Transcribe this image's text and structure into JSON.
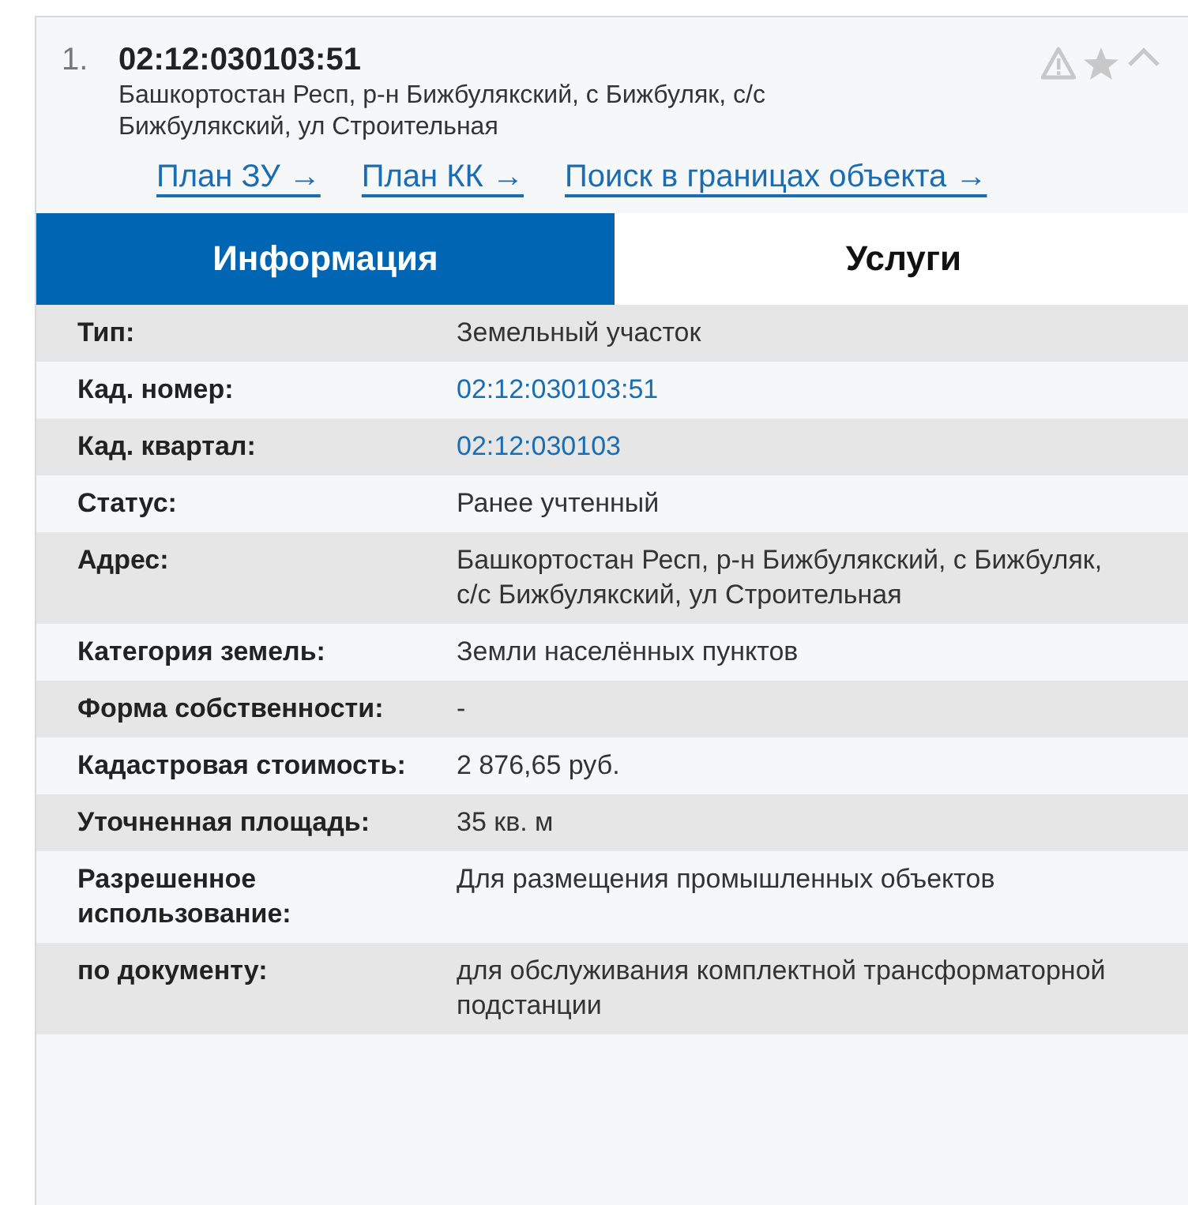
{
  "result": {
    "index": "1.",
    "title": "02:12:030103:51",
    "address": "Башкортостан Респ, р-н Бижбулякский, с Бижбуляк, с/с Бижбулякский, ул Строительная",
    "links": [
      "План ЗУ →",
      "План КК →",
      "Поиск в границах объекта →"
    ]
  },
  "tabs": [
    {
      "label": "Информация",
      "selected": true
    },
    {
      "label": "Услуги",
      "selected": false
    }
  ],
  "rows": [
    {
      "label": "Тип:",
      "value": "Земельный участок",
      "kind": "text"
    },
    {
      "label": "Кад. номер:",
      "value": "02:12:030103:51",
      "kind": "link"
    },
    {
      "label": "Кад. квартал:",
      "value": "02:12:030103",
      "kind": "link"
    },
    {
      "label": "Статус:",
      "value": "Ранее учтенный",
      "kind": "text"
    },
    {
      "label": "Адрес:",
      "value": "Башкортостан Респ, р-н Бижбулякский, с Бижбуляк, с/с Бижбулякский, ул Строительная",
      "kind": "text"
    },
    {
      "label": "Категория земель:",
      "value": "Земли населённых пунктов",
      "kind": "text"
    },
    {
      "label": "Форма собственности:",
      "value": "-",
      "kind": "text"
    },
    {
      "label": "Кадастровая стоимость:",
      "value": "2 876,65 руб.",
      "kind": "text"
    },
    {
      "label": "Уточненная площадь:",
      "value": "35 кв. м",
      "kind": "text"
    },
    {
      "label": "Разрешенное использование:",
      "value": "Для размещения промышленных объектов",
      "kind": "text"
    },
    {
      "label": "по документу:",
      "value": "для обслуживания комплектной трансформаторной подстанции",
      "kind": "text"
    }
  ]
}
